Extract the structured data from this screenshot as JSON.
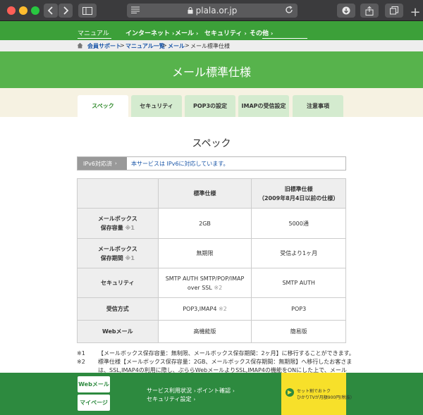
{
  "browser": {
    "url": "plala.or.jp",
    "icons": [
      "back-icon",
      "forward-icon",
      "sidebar-icon",
      "reader-icon",
      "lock-icon",
      "reload-icon",
      "download-icon",
      "share-icon",
      "tabs-icon",
      "new-tab-icon"
    ]
  },
  "nav": {
    "cut_items": [
      "...",
      "...",
      "...",
      "...",
      "..."
    ],
    "items": [
      {
        "label": "マニュアル",
        "bold": false
      },
      {
        "label": "インターネット",
        "bold": true
      },
      {
        "label": "メール",
        "bold": true
      },
      {
        "label": "セキュリティ",
        "bold": true
      },
      {
        "label": "その他",
        "bold": true
      }
    ]
  },
  "breadcrumb": {
    "items": [
      "会員サポート",
      "マニュアル一覧",
      "メール",
      "メール標準仕様"
    ],
    "separator": ">"
  },
  "hero": {
    "title": "メール標準仕様"
  },
  "tabs": [
    {
      "label": "スペック",
      "active": true
    },
    {
      "label": "セキュリティ",
      "active": false
    },
    {
      "label": "POP3の設定",
      "active": false
    },
    {
      "label": "IMAPの受信設定",
      "active": false
    },
    {
      "label": "注意事項",
      "active": false
    }
  ],
  "section": {
    "title": "スペック"
  },
  "ipv6": {
    "label": "IPv6対応済",
    "text": "本サービスは IPv6に対応しています。"
  },
  "table": {
    "header": {
      "col1": "標準仕様",
      "col2_line1": "旧標準仕様",
      "col2_line2": "（2009年8月4日以前の仕様）"
    },
    "rows": [
      {
        "head_line1": "メールボックス",
        "head_line2": "保存容量",
        "head_note": "※1",
        "std": "2GB",
        "std_note": "",
        "old": "5000通"
      },
      {
        "head_line1": "メールボックス",
        "head_line2": "保存期間",
        "head_note": "※1",
        "std": "無期限",
        "std_note": "",
        "old": "受信より1ヶ月"
      },
      {
        "head_line1": "セキュリティ",
        "head_line2": "",
        "head_note": "",
        "std": "SMTP AUTH SMTP/POP/IMAP",
        "std_line2": "over SSL",
        "std_note": "※2",
        "old": "SMTP AUTH"
      },
      {
        "head_line1": "受信方式",
        "head_line2": "",
        "head_note": "",
        "std": "POP3,IMAP4",
        "std_note": "※2",
        "old": "POP3"
      },
      {
        "head_line1": "Webメール",
        "head_line2": "",
        "head_note": "",
        "std": "高機能版",
        "std_note": "",
        "old": "簡易版"
      }
    ]
  },
  "footnotes": [
    {
      "num": "※1",
      "text": "【メールボックス保存容量：無制限、メールボックス保存期間：2ヶ月】に移行することができます。"
    },
    {
      "num": "※2",
      "text": "標準仕様【メールボックス保存容量：2GB、メールボックス保存期間：無期限】へ移行したお客さま"
    },
    {
      "num": "",
      "text": "は、SSL,IMAP4の利用に際し、ぷららWebメールよりSSL,IMAP4の機能をONにした上で、メール"
    }
  ],
  "footer": {
    "buttons": [
      "Webメール",
      "マイページ"
    ],
    "links": [
      "サービス利用状況",
      "ポイント確認",
      "セキュリティ設定"
    ],
    "promo_line1": "セット割でおトク",
    "promo_line2": "ひかりTVが月額900円(税抜)"
  },
  "colors": {
    "nav_green": "#3ca039",
    "hero_green": "#57b34c",
    "tab_green": "#d4ebcf",
    "footer_green": "#2d8a3f",
    "promo_yellow": "#f7e02a",
    "link_blue": "#1a56a8"
  }
}
